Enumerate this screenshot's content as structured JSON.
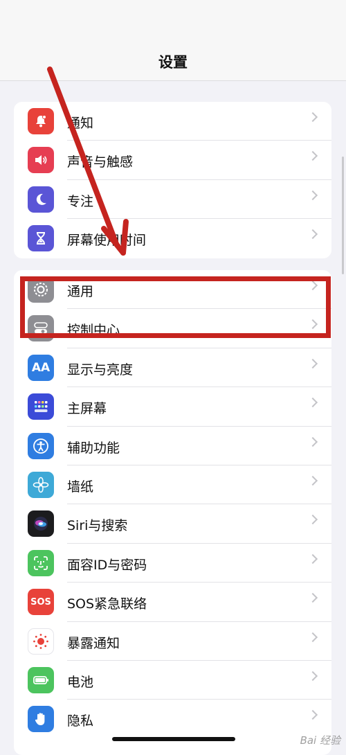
{
  "header": {
    "title": "设置"
  },
  "group1": [
    {
      "label": "通知",
      "icon": "bell-icon",
      "color": "#e8423a"
    },
    {
      "label": "声音与触感",
      "icon": "speaker-icon",
      "color": "#e63e52"
    },
    {
      "label": "专注",
      "icon": "moon-icon",
      "color": "#5a55d6"
    },
    {
      "label": "屏幕使用时间",
      "icon": "hourglass-icon",
      "color": "#5a55d6"
    }
  ],
  "group2": [
    {
      "label": "通用",
      "icon": "gear-icon",
      "color": "#8e8e93"
    },
    {
      "label": "控制中心",
      "icon": "toggle-icon",
      "color": "#8e8e93"
    },
    {
      "label": "显示与亮度",
      "icon": "aa-icon",
      "color": "#2f7de1",
      "text": "AA"
    },
    {
      "label": "主屏幕",
      "icon": "grid-icon",
      "color": "#3b4bd8"
    },
    {
      "label": "辅助功能",
      "icon": "accessibility-icon",
      "color": "#2f7de1"
    },
    {
      "label": "墙纸",
      "icon": "flower-icon",
      "color": "#3ea9d7"
    },
    {
      "label": "Siri与搜索",
      "icon": "siri-icon",
      "color": "#222"
    },
    {
      "label": "面容ID与密码",
      "icon": "faceid-icon",
      "color": "#4cc45e"
    },
    {
      "label": "SOS紧急联络",
      "icon": "sos-icon",
      "color": "#e8423a",
      "text": "SOS"
    },
    {
      "label": "暴露通知",
      "icon": "exposure-icon",
      "color": "#ffffff"
    },
    {
      "label": "电池",
      "icon": "battery-icon",
      "color": "#4cc45e"
    },
    {
      "label": "隐私",
      "icon": "hand-icon",
      "color": "#2f7de1"
    }
  ],
  "watermark": "Bai 经验"
}
